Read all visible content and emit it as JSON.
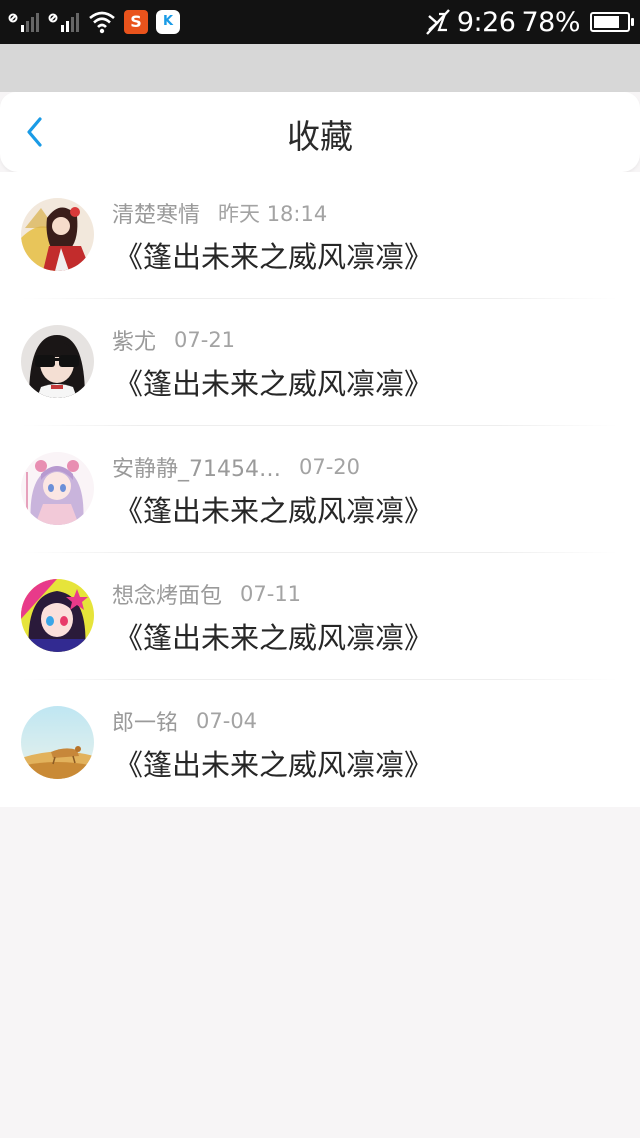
{
  "status_bar": {
    "time": "9:26",
    "battery_percent": "78%",
    "battery_level": 0.78,
    "apps": [
      {
        "icon": "sogou-app-icon",
        "label": "S"
      },
      {
        "icon": "kugou-app-icon",
        "label": "K"
      }
    ]
  },
  "header": {
    "title": "收藏",
    "back_icon": "chevron-left-icon"
  },
  "items": [
    {
      "user": "清楚寒情",
      "time": "昨天 18:14",
      "title": "《篷出未来之威风凛凛》"
    },
    {
      "user": "紫尤",
      "time": "07-21",
      "title": "《篷出未来之威风凛凛》"
    },
    {
      "user": "安静静_71454…",
      "time": "07-20",
      "title": "《篷出未来之威风凛凛》"
    },
    {
      "user": "想念烤面包",
      "time": "07-11",
      "title": "《篷出未来之威风凛凛》"
    },
    {
      "user": "郎一铭",
      "time": "07-04",
      "title": "《篷出未来之威风凛凛》"
    }
  ],
  "colors": {
    "accent": "#1a9be6",
    "status_bar_bg": "#121212",
    "page_bg": "#f7f5f6"
  }
}
